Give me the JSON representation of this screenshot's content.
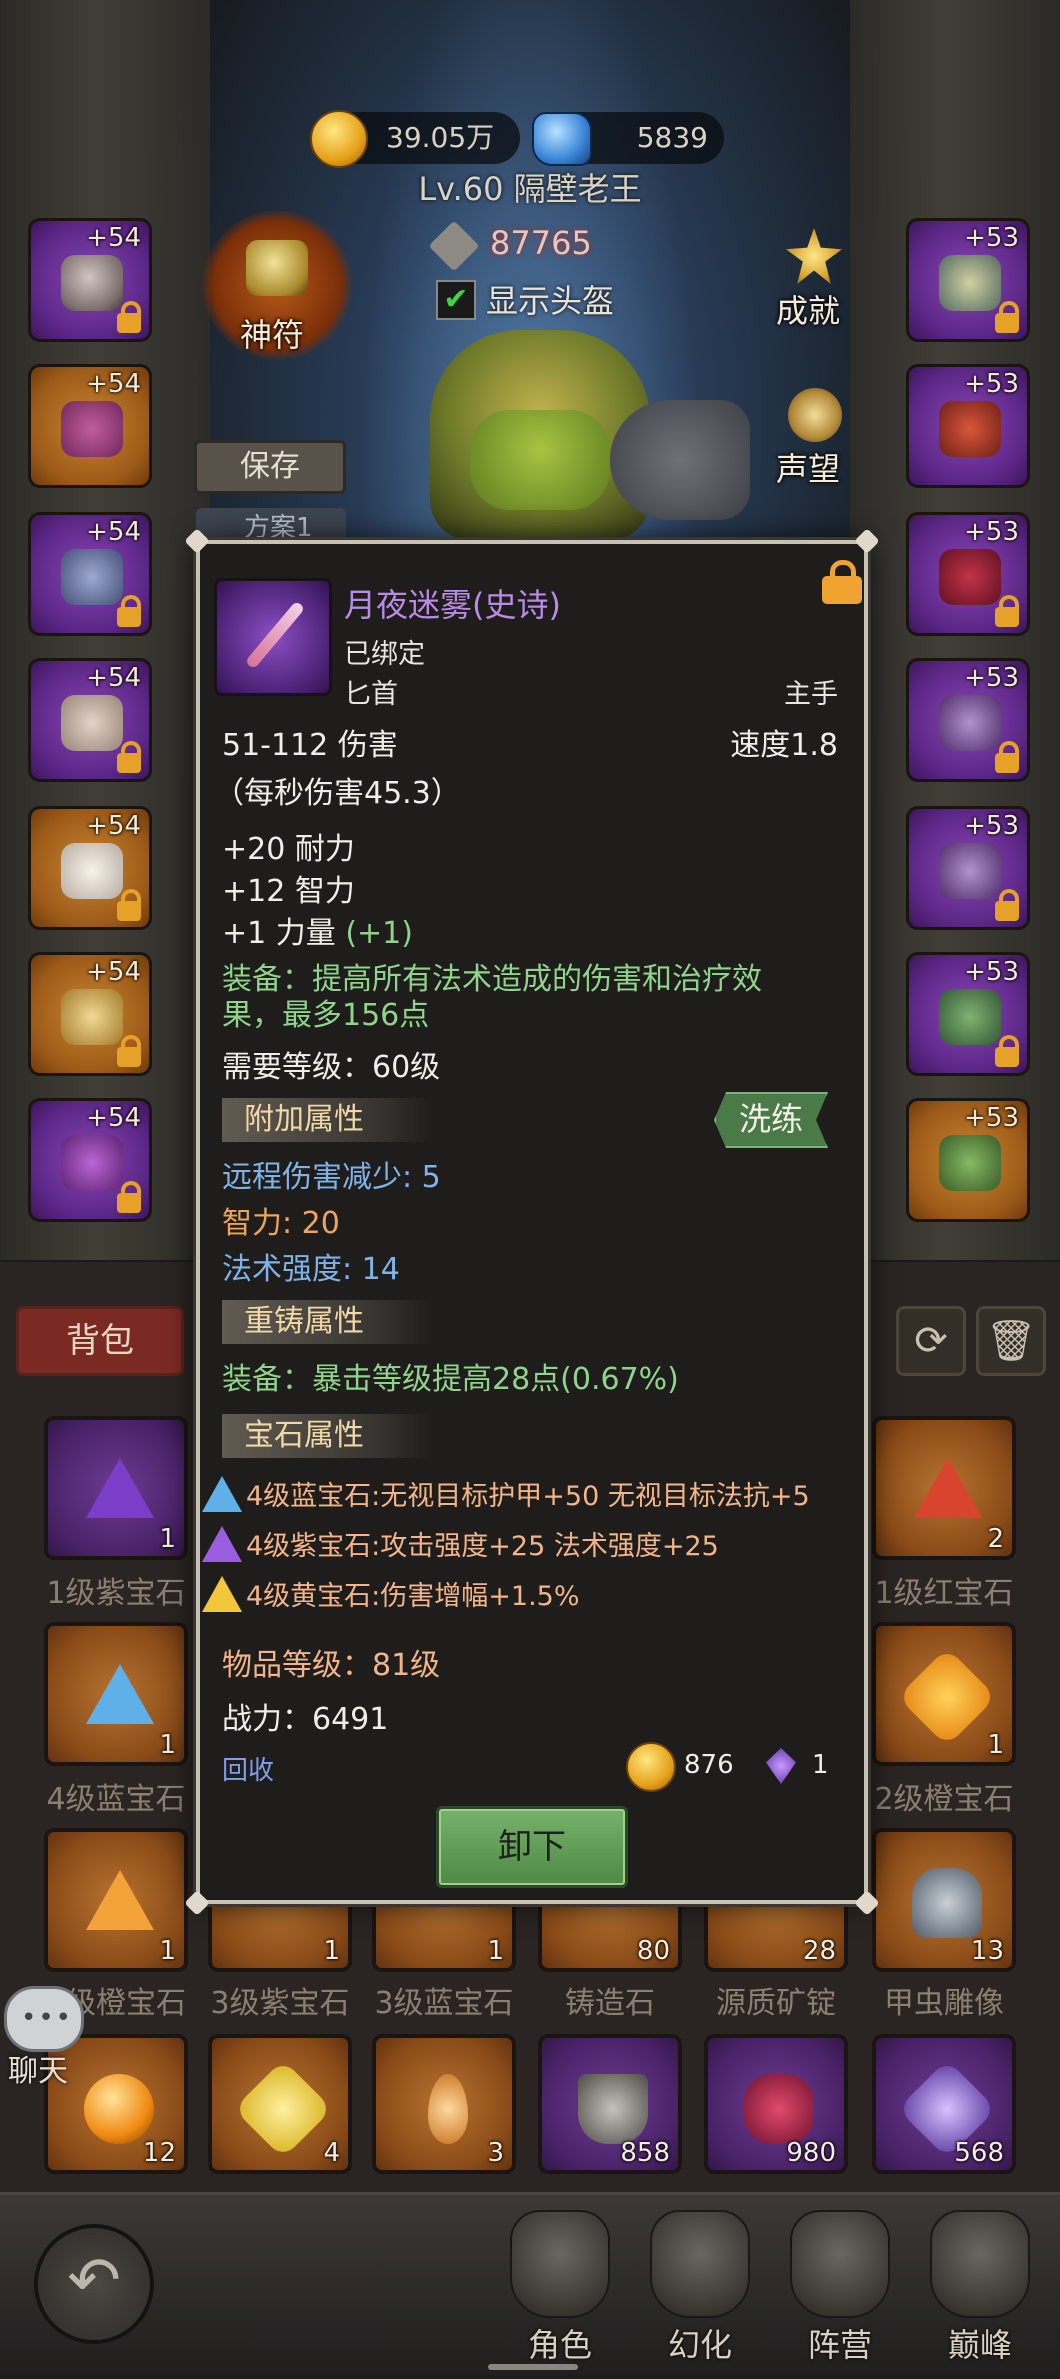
{
  "currency": {
    "gold": "39.05万",
    "gems": "5839"
  },
  "player": {
    "level_name": "Lv.60 隔壁老王",
    "power": "87765",
    "show_helmet": "显示头盔"
  },
  "buttons": {
    "talisman": "神符",
    "achievement": "成就",
    "reputation": "声望",
    "save": "保存",
    "preset": "方案1"
  },
  "left_slots": [
    "+54",
    "+54",
    "+54",
    "+54",
    "+54",
    "+54",
    "+54"
  ],
  "right_slots": [
    "+53",
    "+53",
    "+53",
    "+53",
    "+53",
    "+53",
    "+53"
  ],
  "bag": {
    "tab": "背包",
    "refresh_icon": "refresh-icon",
    "trash_icon": "trash-icon",
    "items": [
      {
        "label": "1级紫宝石",
        "count": "1"
      },
      {
        "label": "1级红宝石",
        "count": "2"
      },
      {
        "label": "4级蓝宝石",
        "count": "1"
      },
      {
        "label": "2级橙宝石",
        "count": "1"
      },
      {
        "label": "级橙宝石",
        "count": "1"
      },
      {
        "label": "3级紫宝石",
        "count": "1"
      },
      {
        "label": "3级蓝宝石",
        "count": "1"
      },
      {
        "label": "铸造石",
        "count": "80"
      },
      {
        "label": "源质矿锭",
        "count": "28"
      },
      {
        "label": "甲虫雕像",
        "count": "13"
      },
      {
        "label": "",
        "count": "12"
      },
      {
        "label": "",
        "count": "4"
      },
      {
        "label": "",
        "count": "3"
      },
      {
        "label": "",
        "count": "858"
      },
      {
        "label": "",
        "count": "980"
      },
      {
        "label": "",
        "count": "568"
      }
    ]
  },
  "chat": "聊天",
  "nav": [
    "角色",
    "幻化",
    "阵营",
    "巅峰"
  ],
  "tooltip": {
    "name": "月夜迷雾(史诗)",
    "bound": "已绑定",
    "type": "匕首",
    "slot": "主手",
    "damage": "51-112 伤害",
    "speed": "速度1.8",
    "dps": "（每秒伤害45.3）",
    "stat1": "+20 耐力",
    "stat2": "+12 智力",
    "stat3": "+1 力量",
    "stat3_bonus": "(+1)",
    "equip_line1": "装备：提高所有法术造成的伤害和治疗效",
    "equip_line2": "果，最多156点",
    "req_level": "需要等级：60级",
    "extra_header": "附加属性",
    "reroll": "洗练",
    "extra1": "远程伤害减少: 5",
    "extra2": "智力: 20",
    "extra3": "法术强度: 14",
    "recast_header": "重铸属性",
    "recast1": "装备：暴击等级提高28点(0.67%)",
    "gem_header": "宝石属性",
    "gem1": "4级蓝宝石:无视目标护甲+50 无视目标法抗+5",
    "gem2": "4级紫宝石:攻击强度+25 法术强度+25",
    "gem3": "4级黄宝石:伤害增幅+1.5%",
    "item_level": "物品等级：81级",
    "combat_power": "战力：6491",
    "recycle": "回收",
    "sell_gold": "876",
    "sell_gem": "1",
    "unequip": "卸下"
  },
  "colors": {
    "epic": "#b98ae6",
    "green_text": "#8fd48a",
    "blue_text": "#7fb3e8",
    "orange_text": "#f0a45a",
    "gem_text": "#f2b488",
    "unequip_btn": "#5a9650"
  }
}
